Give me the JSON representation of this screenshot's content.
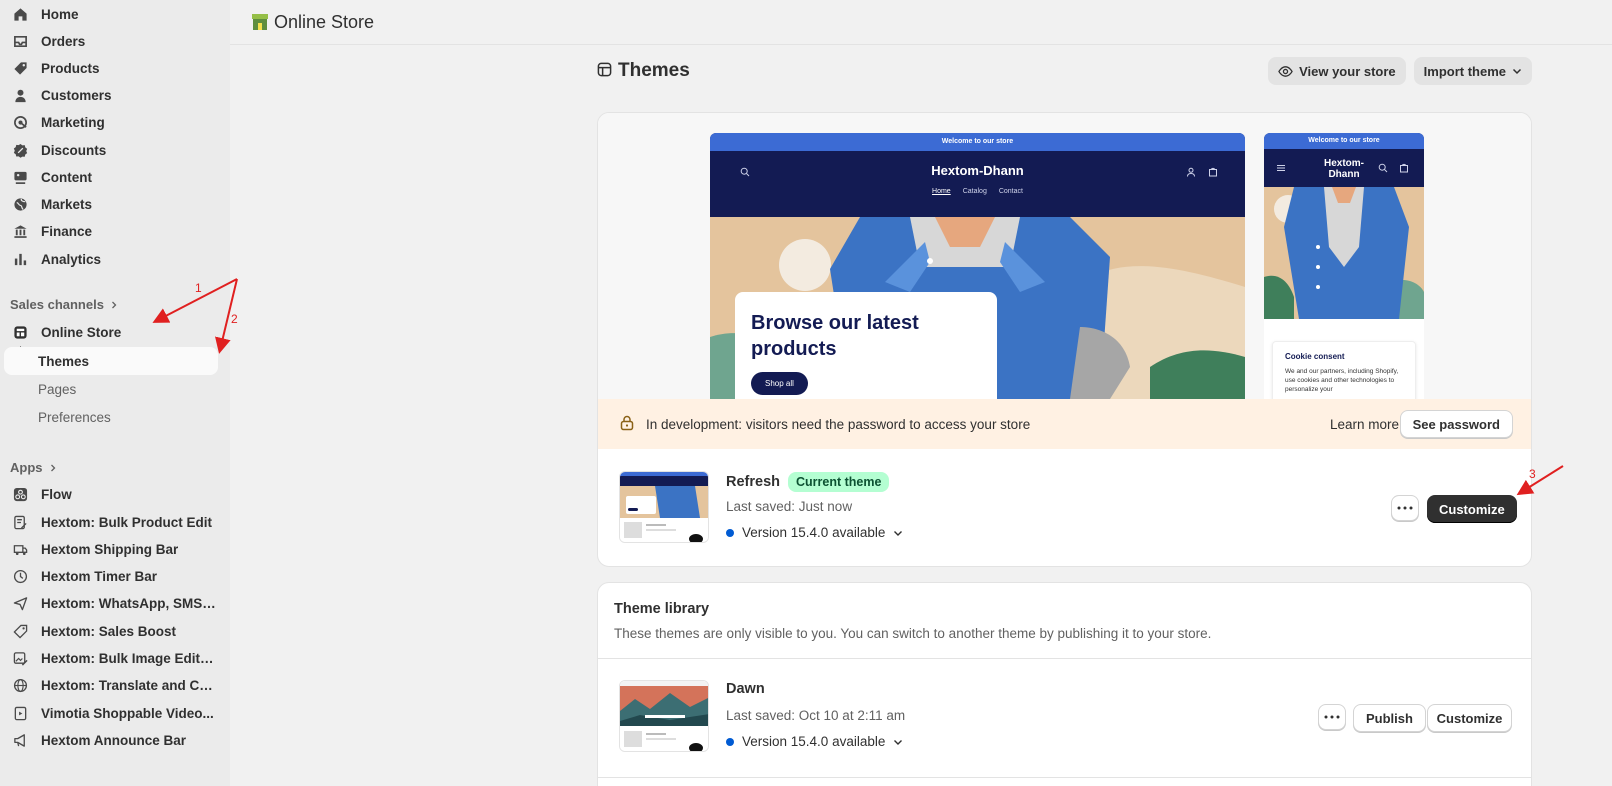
{
  "sidebar": {
    "items": [
      {
        "label": "Home",
        "icon": "home-icon"
      },
      {
        "label": "Orders",
        "icon": "inbox-icon"
      },
      {
        "label": "Products",
        "icon": "tag-icon"
      },
      {
        "label": "Customers",
        "icon": "person-icon"
      },
      {
        "label": "Marketing",
        "icon": "target-icon"
      },
      {
        "label": "Discounts",
        "icon": "discount-icon"
      },
      {
        "label": "Content",
        "icon": "content-icon"
      },
      {
        "label": "Markets",
        "icon": "globe-icon"
      },
      {
        "label": "Finance",
        "icon": "bank-icon"
      },
      {
        "label": "Analytics",
        "icon": "bar-chart-icon"
      }
    ],
    "sales_channels_label": "Sales channels",
    "online_store_label": "Online Store",
    "online_store_sub": [
      "Themes",
      "Pages",
      "Preferences"
    ],
    "apps_label": "Apps",
    "apps": [
      {
        "label": "Flow",
        "icon": "flow-icon"
      },
      {
        "label": "Hextom: Bulk Product Edit",
        "icon": "edit-doc-icon"
      },
      {
        "label": "Hextom Shipping Bar",
        "icon": "shipping-icon"
      },
      {
        "label": "Hextom Timer Bar",
        "icon": "clock-icon"
      },
      {
        "label": "Hextom: WhatsApp, SMS ...",
        "icon": "send-icon"
      },
      {
        "label": "Hextom: Sales Boost",
        "icon": "tag-outline-icon"
      },
      {
        "label": "Hextom: Bulk Image Edit &...",
        "icon": "image-edit-icon"
      },
      {
        "label": "Hextom: Translate and Cu...",
        "icon": "globe-outline-icon"
      },
      {
        "label": "Vimotia Shoppable Video...",
        "icon": "video-doc-icon"
      },
      {
        "label": "Hextom Announce Bar",
        "icon": "megaphone-icon"
      }
    ]
  },
  "topbar": {
    "title": "Online Store"
  },
  "page": {
    "title": "Themes",
    "view_store_label": "View your store",
    "import_theme_label": "Import theme"
  },
  "preview": {
    "announcement": "Welcome to our store",
    "brand": "Hextom-Dhann",
    "mobile_brand_line1": "Hextom-",
    "mobile_brand_line2": "Dhann",
    "menu": [
      "Home",
      "Catalog",
      "Contact"
    ],
    "hero_heading": "Browse our latest products",
    "hero_button": "Shop all",
    "consent_title": "Cookie consent",
    "consent_text": "We and our partners, including Shopify, use cookies and other technologies to personalize your"
  },
  "banner": {
    "text": "In development: visitors need the password to access your store",
    "learn_more": "Learn more",
    "see_password": "See password"
  },
  "current_theme": {
    "name": "Refresh",
    "badge": "Current theme",
    "last_saved": "Last saved: Just now",
    "version": "Version 15.4.0 available",
    "customize": "Customize"
  },
  "library": {
    "title": "Theme library",
    "description": "These themes are only visible to you. You can switch to another theme by publishing it to your store.",
    "themes": [
      {
        "name": "Dawn",
        "last_saved": "Last saved: Oct 10 at 2:11 am",
        "version": "Version 15.4.0 available",
        "publish": "Publish",
        "customize": "Customize"
      }
    ]
  },
  "annotations": [
    "1",
    "2",
    "3"
  ],
  "colors": {
    "accent_red": "#e02020",
    "badge_green": "#b4fed2",
    "banner_bg": "#fff1e3",
    "store_navy": "#131b53",
    "version_dot": "#005bd3"
  }
}
